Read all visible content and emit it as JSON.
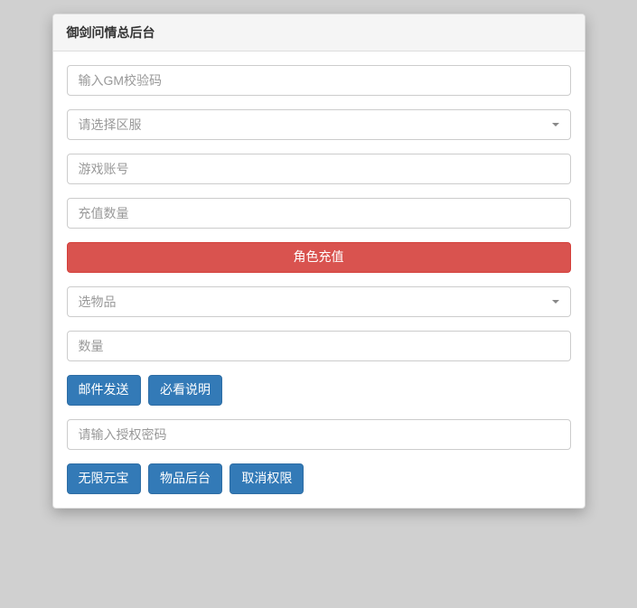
{
  "panel": {
    "title": "御剑问情总后台"
  },
  "form": {
    "gm_code_placeholder": "输入GM校验码",
    "server_select_placeholder": "请选择区服",
    "account_placeholder": "游戏账号",
    "recharge_amount_placeholder": "充值数量",
    "recharge_button": "角色充值",
    "item_select_placeholder": "选物品",
    "quantity_placeholder": "数量",
    "mail_send_button": "邮件发送",
    "must_read_button": "必看说明",
    "auth_password_placeholder": "请输入授权密码",
    "unlimited_yuanbao_button": "无限元宝",
    "item_backend_button": "物品后台",
    "revoke_permission_button": "取消权限"
  }
}
